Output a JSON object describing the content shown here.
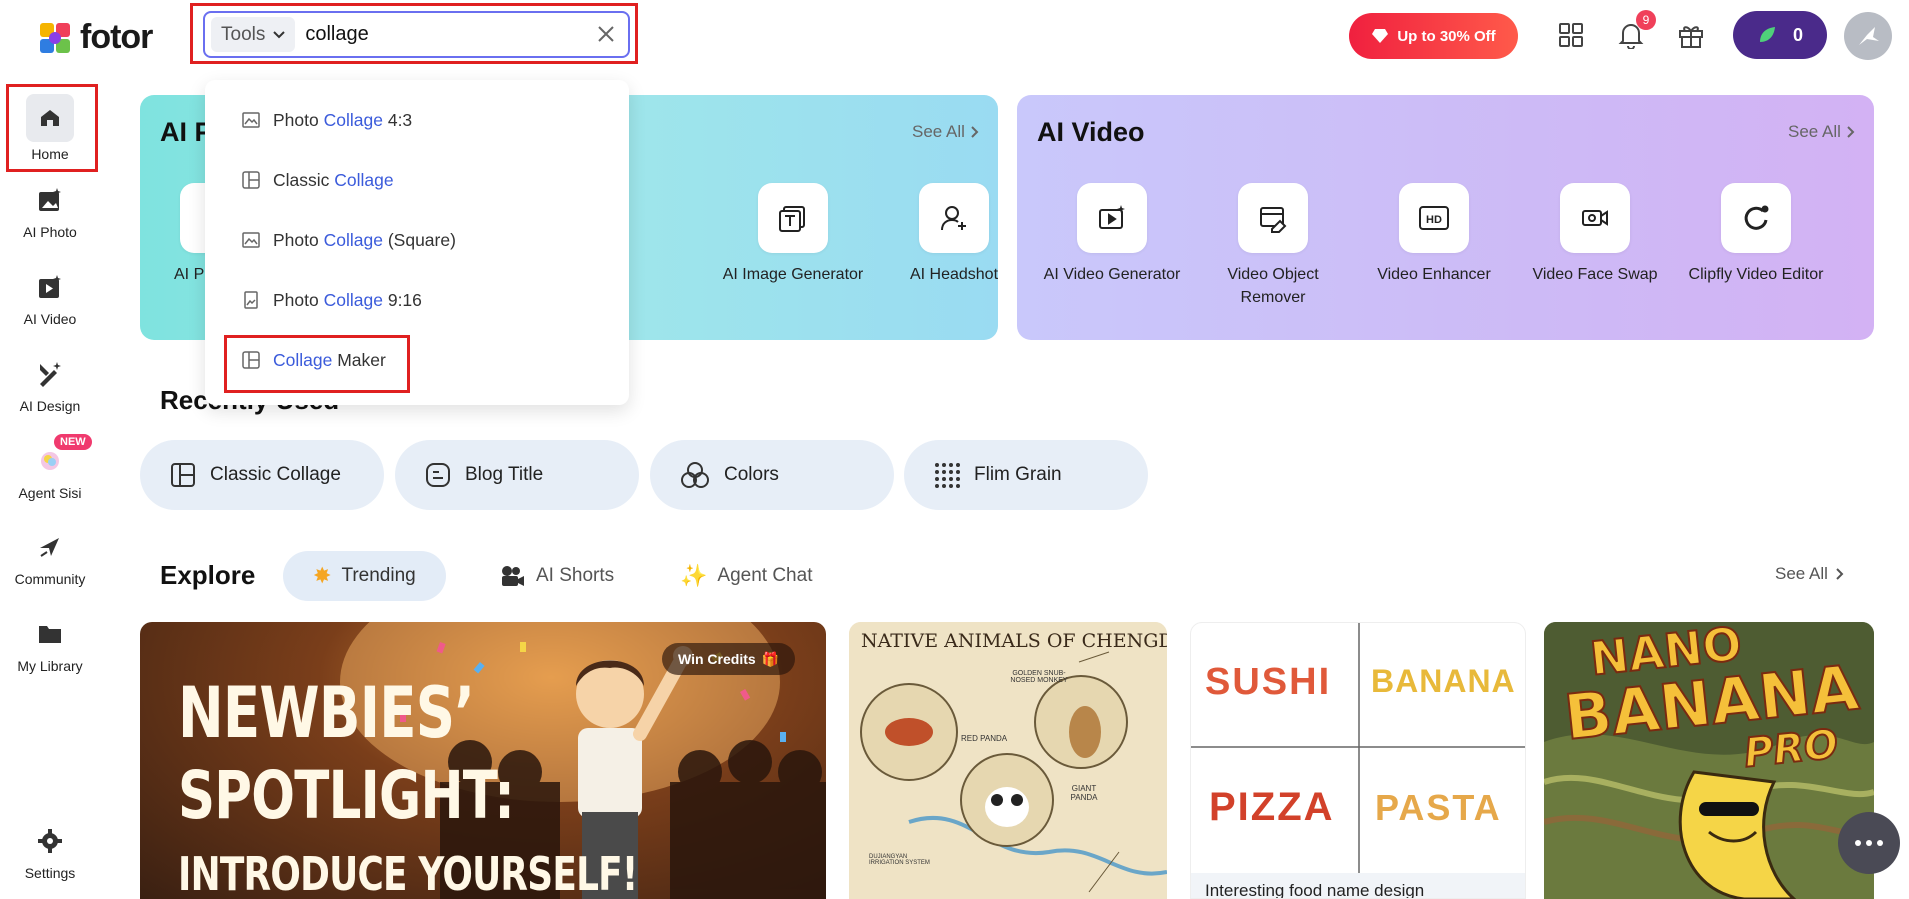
{
  "brand": {
    "name": "fotor"
  },
  "search": {
    "category": "Tools",
    "value": "collage",
    "suggestions": [
      {
        "prefix": "Photo ",
        "match": "Collage",
        "suffix": " 4:3",
        "icon": "image-icon"
      },
      {
        "prefix": "Classic ",
        "match": "Collage",
        "suffix": "",
        "icon": "layout-icon"
      },
      {
        "prefix": "Photo ",
        "match": "Collage",
        "suffix": " (Square)",
        "icon": "image-icon"
      },
      {
        "prefix": "Photo ",
        "match": "Collage",
        "suffix": " 9:16",
        "icon": "portrait-image-icon"
      },
      {
        "prefix": "",
        "match": "Collage",
        "suffix": " Maker",
        "icon": "layout-icon"
      }
    ]
  },
  "header": {
    "promo_label": "Up to 30% Off",
    "notification_count": "9",
    "credits": "0"
  },
  "sidebar": {
    "items": [
      {
        "label": "Home"
      },
      {
        "label": "AI Photo"
      },
      {
        "label": "AI Video"
      },
      {
        "label": "AI Design"
      },
      {
        "label": "Agent Sisi",
        "badge": "NEW"
      },
      {
        "label": "Community"
      },
      {
        "label": "My Library"
      },
      {
        "label": "Settings"
      }
    ]
  },
  "ai_photo": {
    "title": "AI P",
    "see_all": "See All",
    "tools": [
      {
        "label": "AI P"
      },
      {
        "label": "AI Image Generator"
      },
      {
        "label": "AI Headshot"
      }
    ]
  },
  "ai_video": {
    "title": "AI Video",
    "see_all": "See All",
    "tools": [
      {
        "label": "AI Video Generator"
      },
      {
        "label": "Video Object Remover"
      },
      {
        "label": "Video Enhancer"
      },
      {
        "label": "Video Face Swap"
      },
      {
        "label": "Clipfly Video Editor"
      }
    ]
  },
  "recently_used": {
    "title": "Recently Used",
    "chips": [
      "Classic Collage",
      "Blog Title",
      "Colors",
      "Flim Grain"
    ]
  },
  "explore": {
    "title": "Explore",
    "tabs": [
      "Trending",
      "AI Shorts",
      "Agent Chat"
    ],
    "see_all": "See All",
    "tiles": {
      "spotlight_badge": "Win Credits",
      "spotlight_lines": [
        "NEWBIES’",
        "SPOTLIGHT:",
        "INTRODUCE YOURSELF!"
      ],
      "map_title": "NATIVE ANIMALS OF CHENGDU",
      "map_labels": [
        "GOLDEN SNUB-NOSED MONKEY",
        "RED PANDA",
        "GIANT PANDA",
        "DUJIANGYAN IRRIGATION SYSTEM"
      ],
      "food_words": [
        "SUSHI",
        "BANANA",
        "PIZZA",
        "PASTA"
      ],
      "food_caption": "Interesting food name design",
      "poster_lines": [
        "NANO",
        "BANANA",
        "PRO"
      ]
    }
  }
}
